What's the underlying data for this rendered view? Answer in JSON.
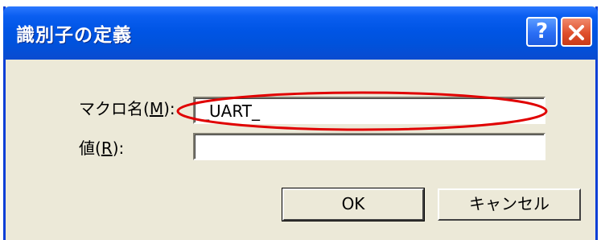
{
  "dialog": {
    "title": "識別子の定義",
    "help_label": "?",
    "macro_label": "マクロ名(",
    "macro_accel": "M",
    "macro_label_end": "):",
    "macro_value": "_UART_",
    "value_label": "値(",
    "value_accel": "R",
    "value_label_end": "):",
    "value_value": "",
    "ok_label": "OK",
    "cancel_label": "キャンセル"
  },
  "colors": {
    "titlebar": "#0054e3",
    "face": "#ece9d8",
    "close": "#e0502c",
    "annotation": "#e00000"
  }
}
